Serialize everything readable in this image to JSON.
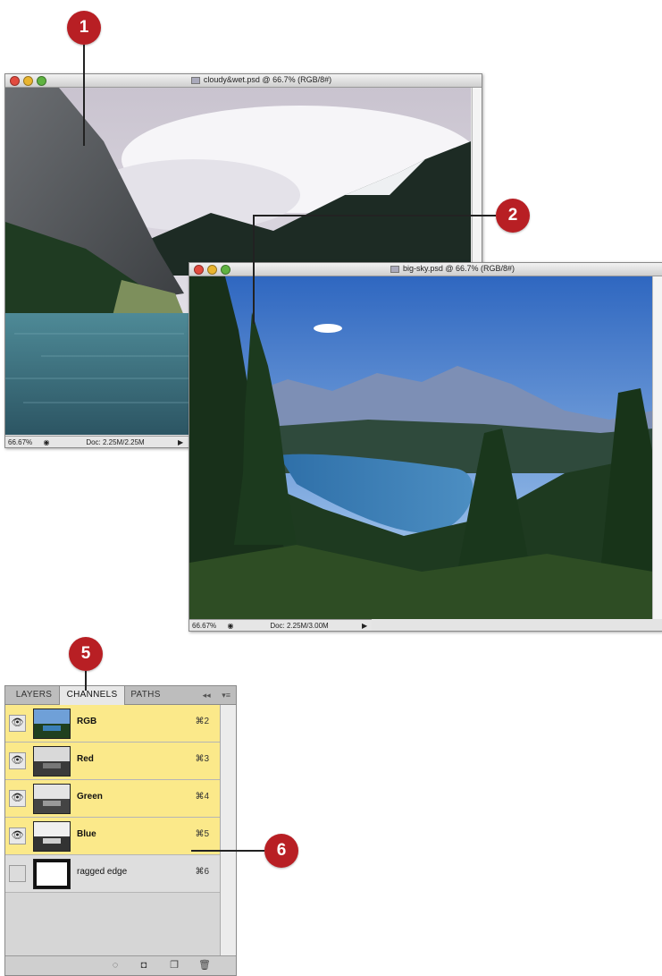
{
  "callouts": {
    "c1": "1",
    "c2": "2",
    "c5": "5",
    "c6": "6"
  },
  "window1": {
    "title": "cloudy&wet.psd @ 66.7% (RGB/8#)",
    "zoom": "66.67%",
    "doc": "Doc: 2.25M/2.25M"
  },
  "window2": {
    "title": "big-sky.psd @ 66.7% (RGB/8#)",
    "zoom": "66.67%",
    "doc": "Doc: 2.25M/3.00M"
  },
  "panel": {
    "tabs": [
      "LAYERS",
      "CHANNELS",
      "PATHS"
    ],
    "active_tab": "CHANNELS",
    "collapse": "◂◂",
    "menu": "▾≡",
    "channels": [
      {
        "name": "RGB",
        "shortcut": "⌘2",
        "visible": true
      },
      {
        "name": "Red",
        "shortcut": "⌘3",
        "visible": true
      },
      {
        "name": "Green",
        "shortcut": "⌘4",
        "visible": true
      },
      {
        "name": "Blue",
        "shortcut": "⌘5",
        "visible": true
      },
      {
        "name": "ragged edge",
        "shortcut": "⌘6",
        "visible": false
      }
    ]
  },
  "colors": {
    "callout": "#b81f24",
    "selected_row": "#fbe98a"
  }
}
